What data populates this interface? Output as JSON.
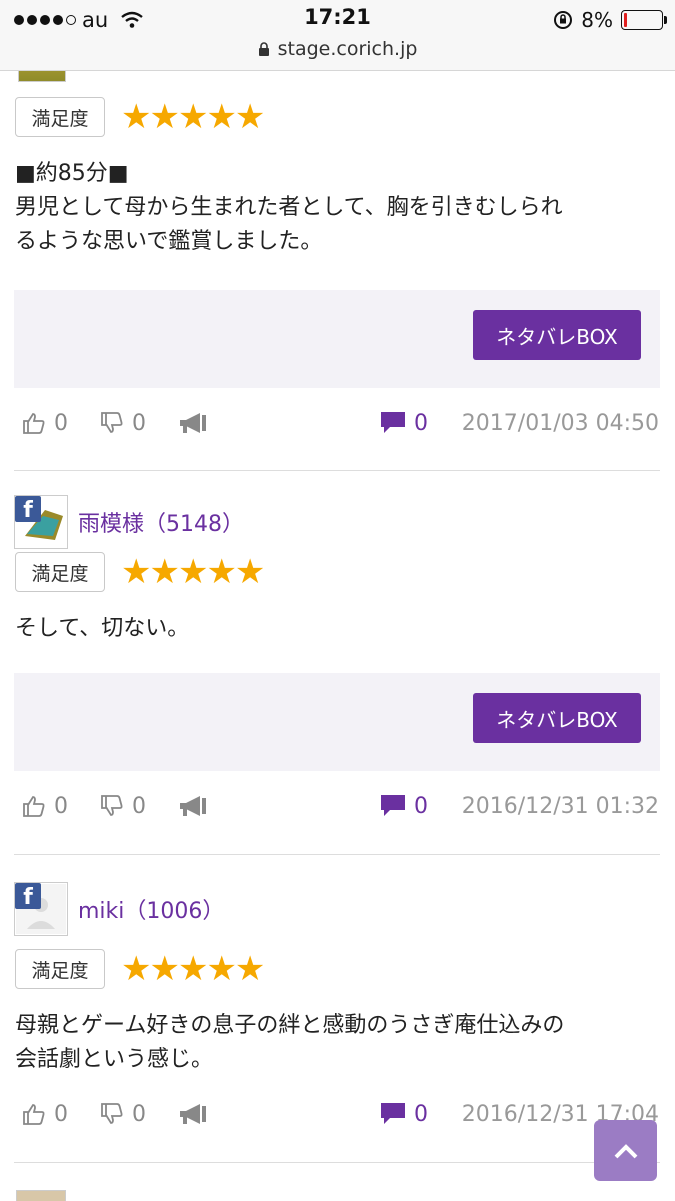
{
  "status_bar": {
    "carrier": "au",
    "time": "17:21",
    "battery_percent": "8%",
    "battery_level": 0.08,
    "url": "stage.corich.jp"
  },
  "reviews": [
    {
      "rating_label": "満足度",
      "stars": "★★★★★",
      "text_lines": [
        "■約85分■",
        "男児として母から生まれた者として、胸を引きむしられ",
        "るような思いで鑑賞しました。"
      ],
      "netabare_label": "ネタバレBOX",
      "likes": "0",
      "dislikes": "0",
      "comments": "0",
      "date": "2017/01/03 04:50"
    },
    {
      "user_name": "雨模様（5148）",
      "rating_label": "満足度",
      "stars": "★★★★★",
      "text_lines": [
        "そして、切ない。"
      ],
      "netabare_label": "ネタバレBOX",
      "likes": "0",
      "dislikes": "0",
      "comments": "0",
      "date": "2016/12/31 01:32"
    },
    {
      "user_name": "miki（1006）",
      "rating_label": "満足度",
      "stars": "★★★★★",
      "text_lines": [
        "母親とゲーム好きの息子の絆と感動のうさぎ庵仕込みの",
        "会話劇という感じ。"
      ],
      "likes": "0",
      "dislikes": "0",
      "comments": "0",
      "date": "2016/12/31 17:04"
    }
  ],
  "icons": {
    "like": "thumbs-up-icon",
    "dislike": "thumbs-down-icon",
    "share": "megaphone-icon",
    "comment": "speech-bubble-icon",
    "facebook": "facebook-icon",
    "scroll_top": "chevron-up-icon"
  },
  "colors": {
    "accent": "#6a30a0",
    "star": "#f6a800",
    "box_bg": "#f3f2f7",
    "scroll_top_bg": "#9b7cc4"
  }
}
